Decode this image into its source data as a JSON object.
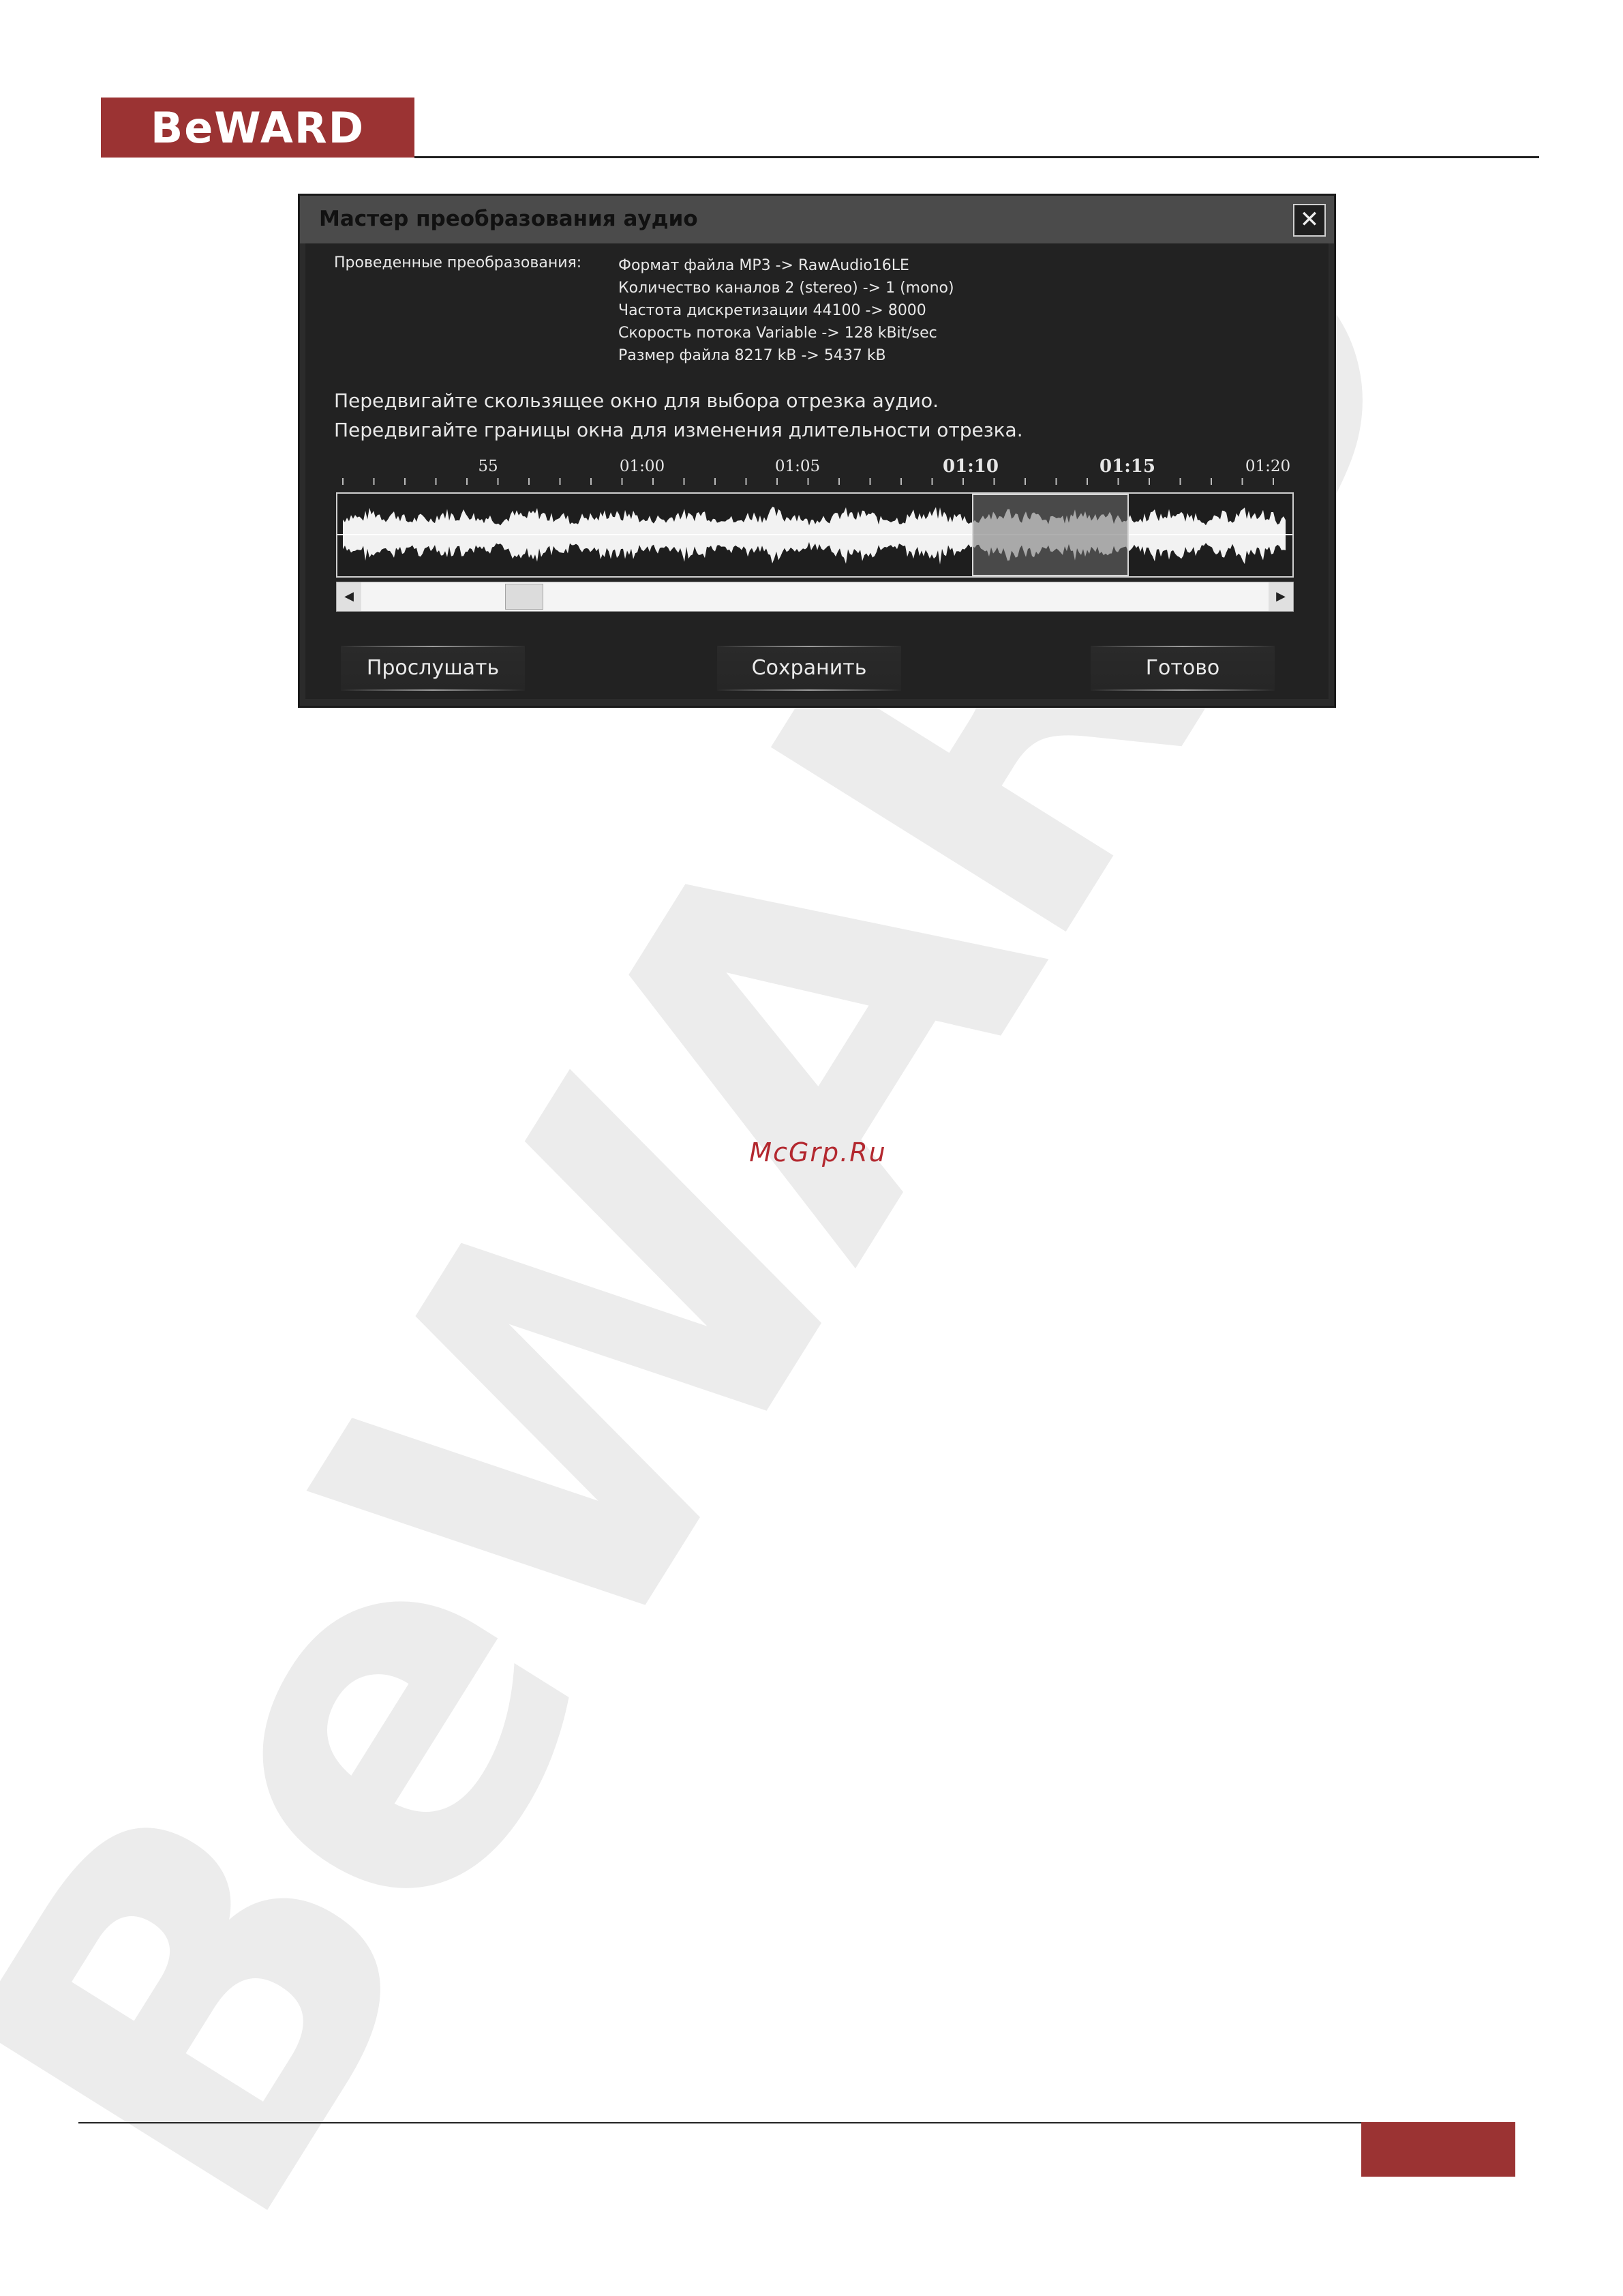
{
  "brand": {
    "logo_text": "BeWARD",
    "accent": "#9b3333"
  },
  "watermark": {
    "text": "BeWARD",
    "site": "McGrp.Ru",
    "site_color": "#b3282f"
  },
  "dialog": {
    "title": "Мастер преобразования аудио",
    "close_icon": "close-icon",
    "conversions_label": "Проведенные преобразования:",
    "conversions": [
      "Формат файла MP3 -> RawAudio16LE",
      "Количество каналов 2 (stereo) -> 1 (mono)",
      "Частота дискретизации 44100 -> 8000",
      "Скорость потока Variable -> 128 kBit/sec",
      "Размер файла 8217 kB -> 5437 kB"
    ],
    "instructions": [
      "Передвигайте скользящее окно для выбора отрезка аудио.",
      "Передвигайте границы окна для изменения длительности отрезка."
    ],
    "timeline_labels": [
      "55",
      "01:00",
      "01:05",
      "01:10",
      "01:15",
      "01:20"
    ],
    "selection_start_label": "01:10",
    "selection_end_label": "01:15",
    "buttons": {
      "listen": "Прослушать",
      "save": "Сохранить",
      "done": "Готово"
    }
  }
}
